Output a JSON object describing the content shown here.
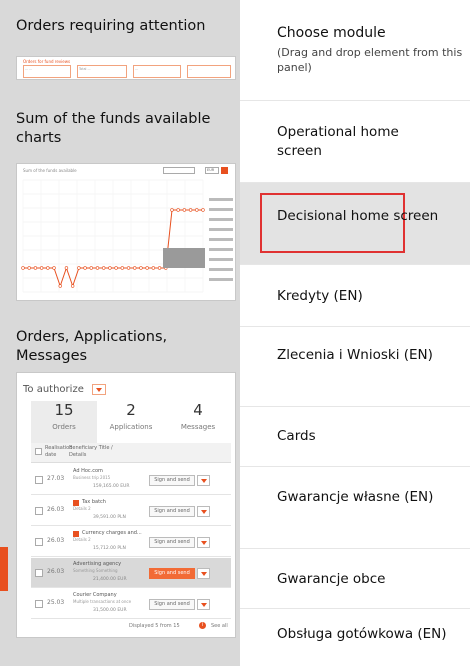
{
  "left_panel": {
    "sections": [
      {
        "title": "Orders requiring attention"
      },
      {
        "title": "Sum of the funds available charts"
      },
      {
        "title": "Orders, Applications, Messages"
      }
    ],
    "orders_thumb": {
      "header": "Orders for fund reviews",
      "cells": [
        "... ...",
        "Total ...",
        "...",
        "..."
      ]
    },
    "chart_thumb": {
      "caption": "Sum of the funds available",
      "currency": "EUR"
    },
    "oam_thumb": {
      "filter_label": "To authorize",
      "tabs": [
        {
          "count": "15",
          "label": "Orders"
        },
        {
          "count": "2",
          "label": "Applications"
        },
        {
          "count": "4",
          "label": "Messages"
        }
      ],
      "header_col1": "Realisation date",
      "header_col2": "Beneficiary Title / Details",
      "rows": [
        {
          "date": "27.03",
          "title": "Ad Hoc.com",
          "sub": "Business trip 2015",
          "amount": "159,165.00 EUR",
          "action": "Sign and send"
        },
        {
          "date": "26.03",
          "title": "Tax batch",
          "sub": "Details 2",
          "amount": "39,591.00 PLN",
          "action": "Sign and send"
        },
        {
          "date": "26.03",
          "title": "Currency charges and...",
          "sub": "Details 2",
          "amount": "15,712.00 PLN",
          "action": "Sign and send"
        },
        {
          "date": "26.03",
          "title": "Advertising agency",
          "sub": "Something Something",
          "amount": "21,400.00 EUR",
          "action": "Sign and send"
        },
        {
          "date": "25.03",
          "title": "Courier Company",
          "sub": "Multiple transactions at once",
          "amount": "31,500.00 EUR",
          "action": "Sign and send"
        }
      ],
      "footer_displayed": "Displayed 5 from 15",
      "footer_see_all": "See all"
    }
  },
  "right_panel": {
    "title": "Choose module",
    "subtitle": "(Drag and drop element from this panel)",
    "modules": [
      "Operational home screen",
      "Decisional home screen",
      "Kredyty (EN)",
      "Zlecenia i Wnioski (EN)",
      "Cards",
      "Gwarancje własne (EN)",
      "Gwarancje obce",
      "Obsługa gotówkowa (EN)"
    ]
  },
  "chart_data": {
    "type": "line",
    "title": "Sum of the funds available",
    "series": [
      {
        "values": [
          0,
          0,
          0,
          0,
          0,
          0,
          -1,
          0,
          -1,
          0,
          0,
          0,
          0,
          0,
          0,
          0,
          0,
          0,
          0,
          0,
          0,
          0,
          0,
          0,
          1,
          1,
          1,
          1,
          1,
          1
        ]
      }
    ],
    "grid": true,
    "legend": "right"
  },
  "colors": {
    "accent": "#e8501f",
    "left_bg": "#d9d9d9",
    "selection_border": "#e03232"
  }
}
